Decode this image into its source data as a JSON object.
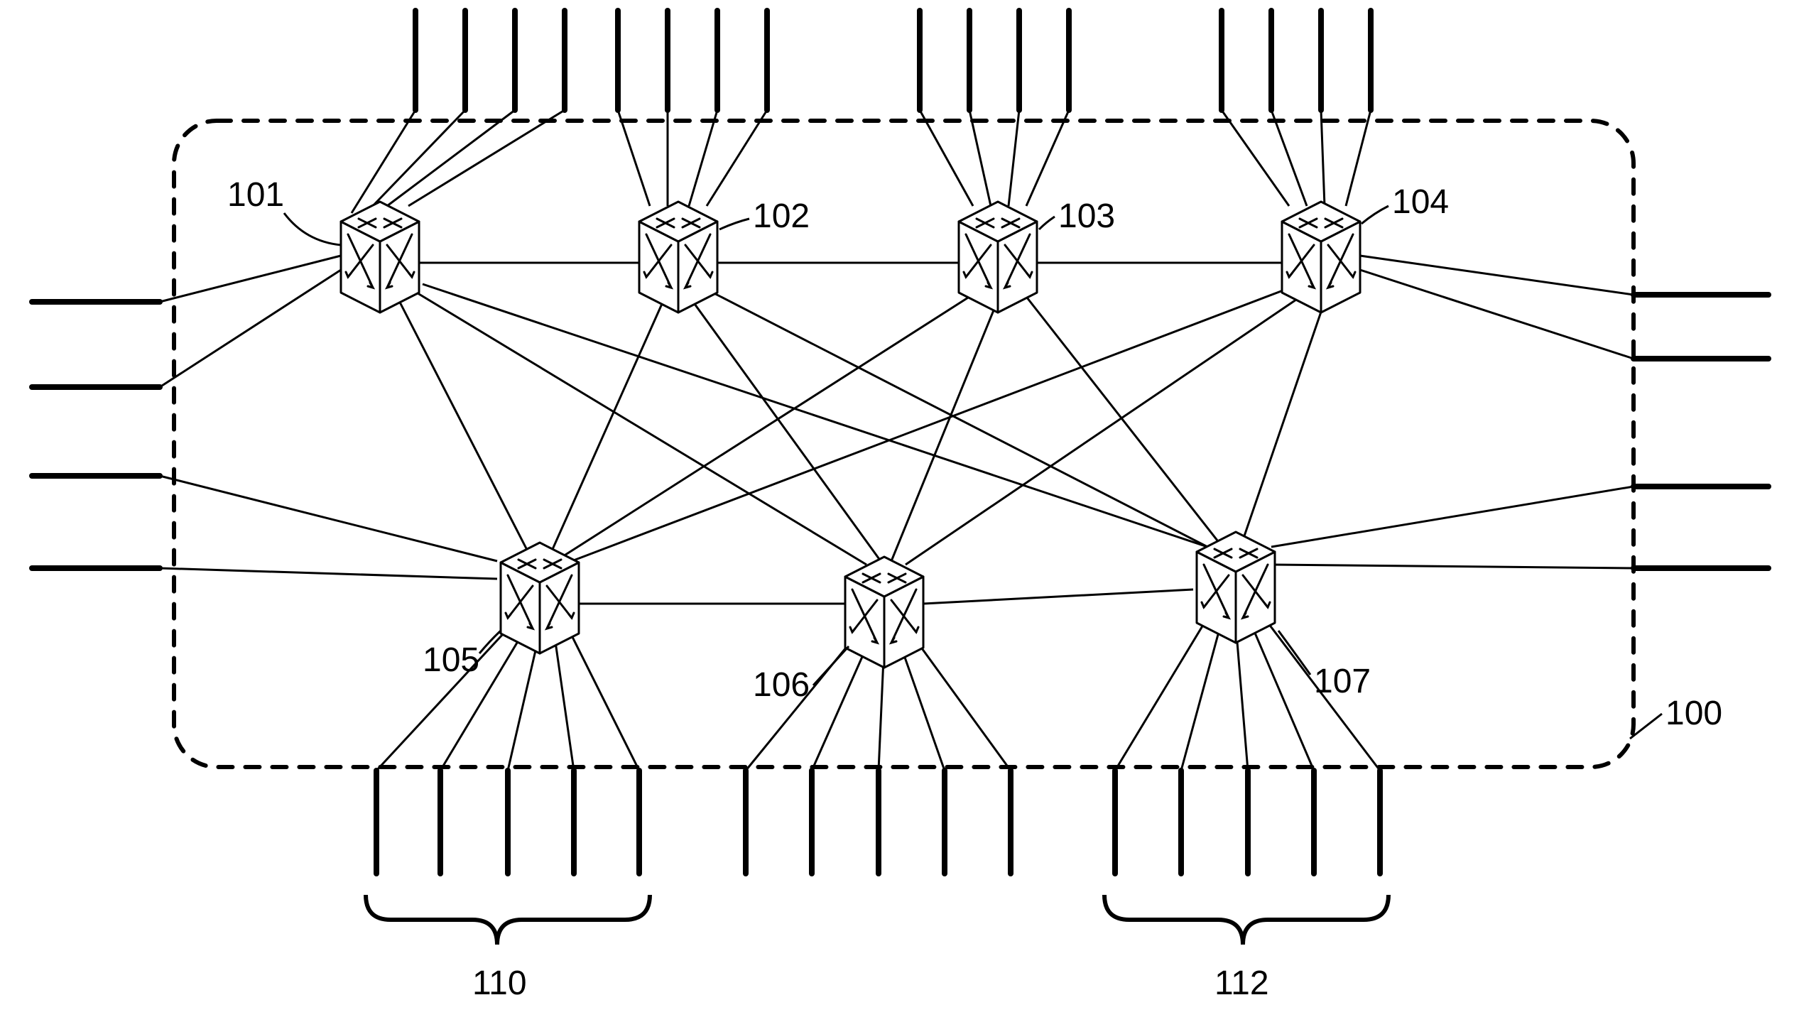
{
  "diagram": {
    "type": "patent-figure",
    "description": "Network/fabric diagram with seven switch cubes inside a dashed rounded boundary, external port lines on all four sides, and curly-brace port groupings at the bottom.",
    "boundary_label": "100",
    "nodes": {
      "n101": {
        "label": "101"
      },
      "n102": {
        "label": "102"
      },
      "n103": {
        "label": "103"
      },
      "n104": {
        "label": "104"
      },
      "n105": {
        "label": "105"
      },
      "n106": {
        "label": "106"
      },
      "n107": {
        "label": "107"
      }
    },
    "groups": {
      "g110": {
        "label": "110"
      },
      "g112": {
        "label": "112"
      }
    }
  }
}
